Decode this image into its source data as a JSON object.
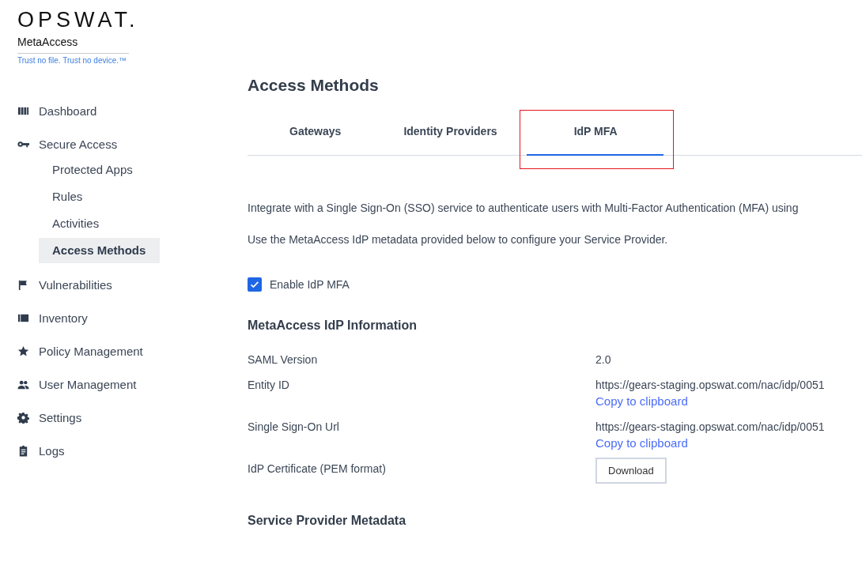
{
  "brand": {
    "logo": "OPSWAT.",
    "product": "MetaAccess",
    "tagline": "Trust no file. Trust no device.™"
  },
  "sidebar": {
    "items": [
      {
        "label": "Dashboard",
        "selected": false
      },
      {
        "label": "Secure Access",
        "selected": false,
        "children": [
          {
            "label": "Protected Apps",
            "selected": false
          },
          {
            "label": "Rules",
            "selected": false
          },
          {
            "label": "Activities",
            "selected": false
          },
          {
            "label": "Access Methods",
            "selected": true
          }
        ]
      },
      {
        "label": "Vulnerabilities",
        "selected": false
      },
      {
        "label": "Inventory",
        "selected": false
      },
      {
        "label": "Policy Management",
        "selected": false
      },
      {
        "label": "User Management",
        "selected": false
      },
      {
        "label": "Settings",
        "selected": false
      },
      {
        "label": "Logs",
        "selected": false
      }
    ]
  },
  "page": {
    "title": "Access Methods",
    "tabs": [
      {
        "label": "Gateways",
        "selected": false,
        "highlighted": false
      },
      {
        "label": "Identity Providers",
        "selected": false,
        "highlighted": false
      },
      {
        "label": "IdP MFA",
        "selected": true,
        "highlighted": true
      }
    ],
    "intro": [
      "Integrate with a Single Sign-On (SSO) service to authenticate users with Multi-Factor Authentication (MFA) using",
      "Use the MetaAccess IdP metadata provided below to configure your Service Provider."
    ],
    "enable": {
      "label": "Enable IdP MFA",
      "checked": true
    },
    "info_heading": "MetaAccess IdP Information",
    "info_rows": [
      {
        "kind": "text",
        "label": "SAML Version",
        "value": "2.0"
      },
      {
        "kind": "copy",
        "label": "Entity ID",
        "value": "https://gears-staging.opswat.com/nac/idp/0051",
        "link": "Copy to clipboard"
      },
      {
        "kind": "copy",
        "label": "Single Sign-On Url",
        "value": "https://gears-staging.opswat.com/nac/idp/0051",
        "link": "Copy to clipboard"
      },
      {
        "kind": "button",
        "label": "IdP Certificate (PEM format)",
        "button": "Download"
      }
    ],
    "sp_heading": "Service Provider Metadata"
  }
}
